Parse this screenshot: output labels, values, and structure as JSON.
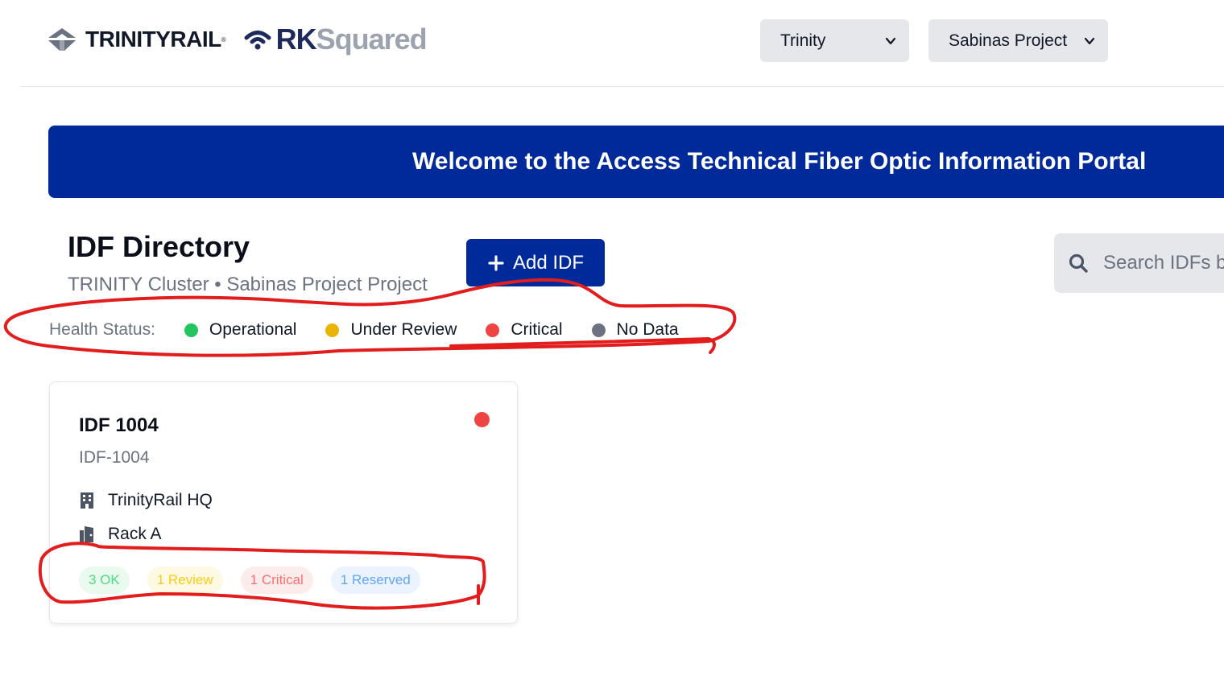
{
  "header": {
    "logo_trinity": "TRINITYRAIL",
    "logo_rk": "RK",
    "logo_squared": "Squared",
    "cluster_select": "Trinity",
    "project_select": "Sabinas Project"
  },
  "banner": {
    "title": "Welcome to the Access Technical Fiber Optic Information Portal"
  },
  "directory": {
    "title": "IDF Directory",
    "subtitle": "TRINITY Cluster • Sabinas Project Project",
    "add_button": "Add IDF",
    "search_placeholder": "Search IDFs by"
  },
  "legend": {
    "label": "Health Status:",
    "items": [
      {
        "label": "Operational",
        "color": "#22c55e"
      },
      {
        "label": "Under Review",
        "color": "#eab308"
      },
      {
        "label": "Critical",
        "color": "#ef4444"
      },
      {
        "label": "No Data",
        "color": "#6b7280"
      }
    ]
  },
  "card": {
    "title": "IDF 1004",
    "id": "IDF-1004",
    "status_color": "#ef4444",
    "location": "TrinityRail HQ",
    "rack": "Rack A",
    "badges": [
      {
        "label": "3 OK",
        "text_color": "#4ade80",
        "bg": "#eafaef"
      },
      {
        "label": "1 Review",
        "text_color": "#facc15",
        "bg": "#fdf9e3"
      },
      {
        "label": "1 Critical",
        "text_color": "#f87171",
        "bg": "#fdecec"
      },
      {
        "label": "1 Reserved",
        "text_color": "#60a5fa",
        "bg": "#ebf3fe"
      }
    ]
  },
  "annotation_color": "#e11d1d"
}
